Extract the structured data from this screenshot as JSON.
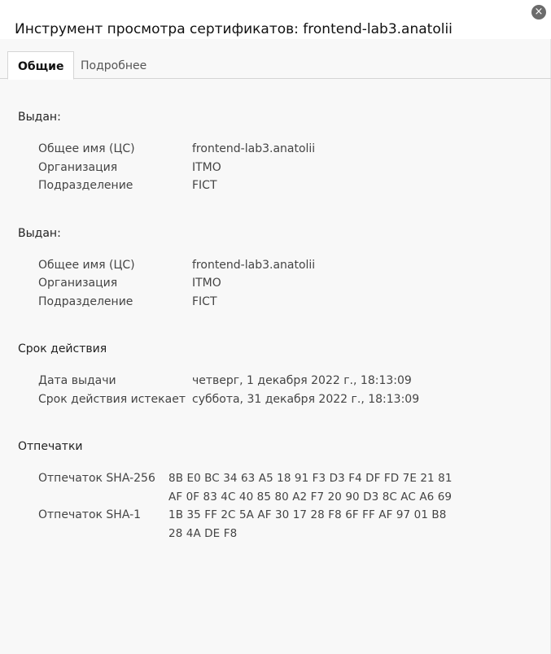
{
  "dialog": {
    "title": "Инструмент просмотра сертификатов: frontend-lab3.anatolii",
    "close_icon": "×"
  },
  "tabs": [
    {
      "label": "Общие",
      "active": true
    },
    {
      "label": "Подробнее",
      "active": false
    }
  ],
  "issued_to": {
    "title": "Выдан:",
    "rows": [
      {
        "label": "Общее имя (ЦС)",
        "value": "frontend-lab3.anatolii"
      },
      {
        "label": "Организация",
        "value": "ITMO"
      },
      {
        "label": "Подразделение",
        "value": "FICT"
      }
    ]
  },
  "issued_by": {
    "title": "Выдан:",
    "rows": [
      {
        "label": "Общее имя (ЦС)",
        "value": "frontend-lab3.anatolii"
      },
      {
        "label": "Организация",
        "value": "ITMO"
      },
      {
        "label": "Подразделение",
        "value": "FICT"
      }
    ]
  },
  "validity": {
    "title": "Срок действия",
    "rows": [
      {
        "label": "Дата выдачи",
        "value": "четверг, 1 декабря 2022 г., 18:13:09"
      },
      {
        "label": "Срок действия истекает",
        "value": "суббота, 31 декабря 2022 г., 18:13:09"
      }
    ]
  },
  "fingerprints": {
    "title": "Отпечатки",
    "sha256": {
      "label": "Отпечаток SHA-256",
      "line1": "8B E0 BC 34 63 A5 18 91 F3 D3 F4 DF FD 7E 21 81",
      "line2": "AF 0F 83 4C 40 85 80 A2 F7 20 90 D3 8C AC A6 69"
    },
    "sha1": {
      "label": "Отпечаток SHA-1",
      "line1": "1B 35 FF 2C 5A AF 30 17 28 F8 6F FF AF 97 01 B8",
      "line2": "28 4A DE F8"
    }
  }
}
